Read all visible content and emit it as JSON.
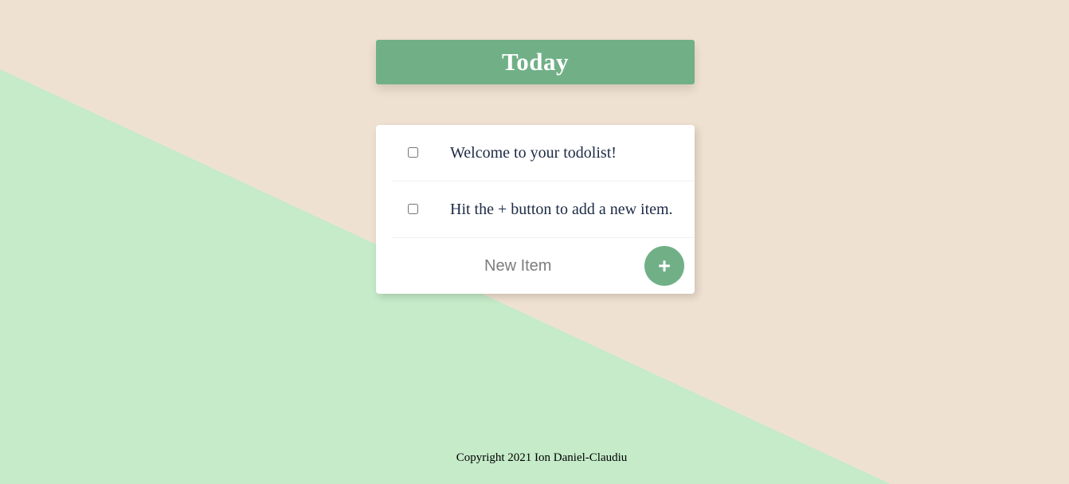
{
  "colors": {
    "background": "#efe1d1",
    "diagonal_shape": "#c5ebc9",
    "accent": "#71b087",
    "card": "#ffffff",
    "item_text": "#1b2a44"
  },
  "header": {
    "title": "Today"
  },
  "todo_list": {
    "items": [
      {
        "label": "Welcome to your todolist!",
        "checked": false
      },
      {
        "label": "Hit the + button to add a new item.",
        "checked": false
      }
    ],
    "new_item": {
      "placeholder": "New Item",
      "value": "",
      "add_button_label": "+"
    }
  },
  "footer": {
    "copyright": "Copyright 2021 Ion Daniel-Claudiu"
  }
}
